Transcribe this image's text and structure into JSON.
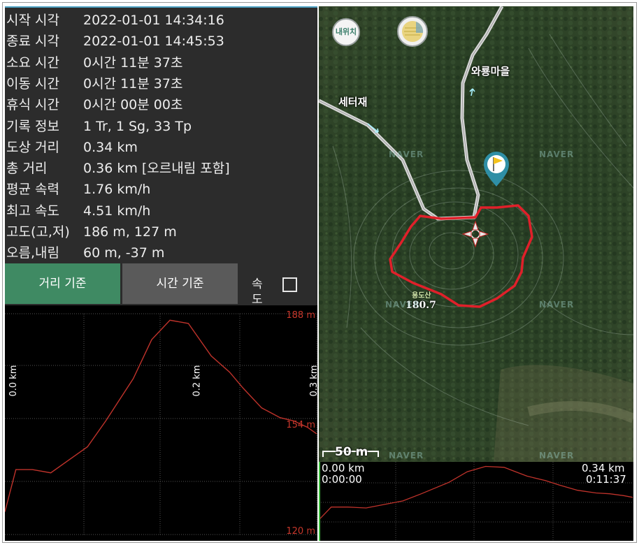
{
  "stats": [
    {
      "label": "시작 시각",
      "value": "2022-01-01 14:34:16"
    },
    {
      "label": "종료 시각",
      "value": "2022-01-01 14:45:53"
    },
    {
      "label": "소요 시간",
      "value": "0시간 11분 37초"
    },
    {
      "label": "이동 시간",
      "value": "0시간 11분 37초"
    },
    {
      "label": "휴식 시간",
      "value": "0시간 00분 00초"
    },
    {
      "label": "기록 정보",
      "value": "1 Tr, 1 Sg, 33 Tp"
    },
    {
      "label": "도상 거리",
      "value": "0.34 km"
    },
    {
      "label": "총 거리",
      "value": "0.36 km [오르내림 포함]"
    },
    {
      "label": "평균 속력",
      "value": "1.76 km/h"
    },
    {
      "label": "최고 속도",
      "value": "4.51 km/h"
    },
    {
      "label": "고도(고,저)",
      "value": "186 m, 127 m"
    },
    {
      "label": "오름,내림",
      "value": "60 m, -37 m"
    }
  ],
  "buttons": {
    "distance": "거리 기준",
    "time": "시간 기준",
    "speed": "속도",
    "speed_checked": false
  },
  "chart_data": [
    {
      "type": "line",
      "x_tick_labels": [
        "0.0 km",
        "0.2 km",
        "0.3 km"
      ],
      "y_tick_labels": [
        "188 m",
        "154 m",
        "120 m"
      ],
      "ylim": [
        120,
        188
      ],
      "grid": true,
      "line_color": "#c0332b",
      "x": [
        0.0,
        0.012,
        0.03,
        0.05,
        0.08,
        0.09,
        0.11,
        0.14,
        0.16,
        0.18,
        0.2,
        0.21,
        0.225,
        0.245,
        0.26,
        0.28,
        0.3,
        0.315,
        0.33,
        0.34
      ],
      "y": [
        127,
        140,
        140,
        139,
        145,
        147,
        155,
        168,
        180,
        186,
        185,
        181,
        175,
        170,
        165,
        159,
        156,
        155,
        153,
        151
      ]
    },
    {
      "type": "line",
      "x_start_label": "0.00 km",
      "time_start_label": "0:00:00",
      "x_end_label": "0.34 km",
      "time_end_label": "0:11:37",
      "line_color": "#c0332b",
      "x": [
        0.0,
        0.012,
        0.03,
        0.05,
        0.08,
        0.09,
        0.11,
        0.14,
        0.16,
        0.18,
        0.2,
        0.21,
        0.225,
        0.245,
        0.26,
        0.28,
        0.3,
        0.315,
        0.33,
        0.34
      ],
      "y": [
        127,
        140,
        140,
        139,
        145,
        147,
        155,
        168,
        180,
        186,
        185,
        181,
        175,
        170,
        165,
        159,
        156,
        155,
        153,
        151
      ]
    }
  ],
  "map": {
    "my_location_button": "내위치",
    "places": [
      "와룡마을",
      "세터재",
      "용도산",
      "180.7"
    ],
    "watermark": "NAVER",
    "scale": "50 m",
    "track_color": "#e0202a",
    "marker_color": "#2f8fa6"
  }
}
